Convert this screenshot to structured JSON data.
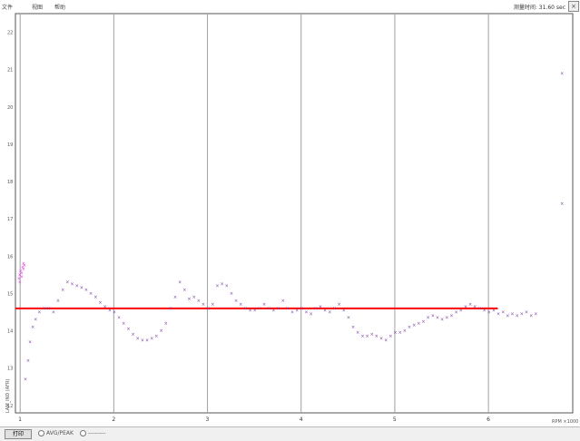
{
  "menu": [
    "文件",
    "视图",
    "帮助"
  ],
  "top_right_text": "测量时间: 31.60 sec",
  "top_right_box": "×",
  "top_marker_text": "■ ■ ■ ■ ■ ■ ■ ■ ■ ■ ■ ■ ■ ■ ■ ■ ■",
  "bottom": {
    "button_label": "打印",
    "radio1_label": "AVG/PEAK",
    "radio2_label": "---------"
  },
  "colors": {
    "plot_border": "#555555",
    "grid": "#a0a0a0",
    "series": "#8040a0",
    "reference_line": "#ff0000",
    "magenta": "#e040e0"
  },
  "chart_data": {
    "type": "scatter",
    "title": "",
    "xlabel": "RPM ×1000",
    "ylabel": "LAM_IND (AFR)",
    "xlim": [
      0.95,
      6.9
    ],
    "ylim": [
      11.8,
      22.5
    ],
    "x_ticks": [
      1,
      2,
      3,
      4,
      5,
      6
    ],
    "y_ticks": [
      12,
      13,
      14,
      15,
      16,
      17,
      18,
      19,
      20,
      21,
      22
    ],
    "grid": true,
    "legend": "none",
    "reference_line": 14.6,
    "series": [
      {
        "name": "",
        "x": [
          1.05,
          1.08,
          1.1,
          1.13,
          1.16,
          1.2,
          1.25,
          1.3,
          1.35,
          1.4,
          1.45,
          1.5,
          1.55,
          1.6,
          1.65,
          1.7,
          1.75,
          1.8,
          1.85,
          1.9,
          1.95,
          2.0,
          2.05,
          2.1,
          2.15,
          2.2,
          2.25,
          2.3,
          2.35,
          2.4,
          2.45,
          2.5,
          2.55,
          2.6,
          2.65,
          2.7,
          2.75,
          2.8,
          2.85,
          2.9,
          2.95,
          3.0,
          3.05,
          3.1,
          3.15,
          3.2,
          3.25,
          3.3,
          3.35,
          3.4,
          3.45,
          3.5,
          3.55,
          3.6,
          3.65,
          3.7,
          3.75,
          3.8,
          3.85,
          3.9,
          3.95,
          4.0,
          4.05,
          4.1,
          4.15,
          4.2,
          4.25,
          4.3,
          4.35,
          4.4,
          4.45,
          4.5,
          4.55,
          4.6,
          4.65,
          4.7,
          4.75,
          4.8,
          4.85,
          4.9,
          4.95,
          5.0,
          5.05,
          5.1,
          5.15,
          5.2,
          5.25,
          5.3,
          5.35,
          5.4,
          5.45,
          5.5,
          5.55,
          5.6,
          5.65,
          5.7,
          5.75,
          5.8,
          5.85,
          5.9,
          5.95,
          6.0,
          6.05,
          6.1,
          6.15,
          6.2,
          6.25,
          6.3,
          6.35,
          6.4,
          6.45,
          6.5
        ],
        "y": [
          12.7,
          13.2,
          13.7,
          14.1,
          14.3,
          14.5,
          14.6,
          14.6,
          14.5,
          14.8,
          15.1,
          15.3,
          15.25,
          15.2,
          15.15,
          15.1,
          15.0,
          14.9,
          14.75,
          14.65,
          14.55,
          14.5,
          14.35,
          14.2,
          14.05,
          13.9,
          13.8,
          13.75,
          13.75,
          13.8,
          13.85,
          14.0,
          14.2,
          14.6,
          14.9,
          15.3,
          15.1,
          14.85,
          14.9,
          14.8,
          14.7,
          14.6,
          14.7,
          15.2,
          15.25,
          15.2,
          15.0,
          14.8,
          14.7,
          14.6,
          14.55,
          14.55,
          14.6,
          14.7,
          14.6,
          14.55,
          14.6,
          14.8,
          14.6,
          14.5,
          14.55,
          14.6,
          14.5,
          14.45,
          14.6,
          14.65,
          14.55,
          14.5,
          14.6,
          14.7,
          14.55,
          14.35,
          14.1,
          13.95,
          13.85,
          13.85,
          13.9,
          13.85,
          13.8,
          13.75,
          13.85,
          13.95,
          13.95,
          14.0,
          14.1,
          14.15,
          14.2,
          14.25,
          14.35,
          14.4,
          14.35,
          14.3,
          14.35,
          14.4,
          14.5,
          14.55,
          14.65,
          14.7,
          14.65,
          14.6,
          14.55,
          14.5,
          14.55,
          14.45,
          14.5,
          14.4,
          14.45,
          14.4,
          14.45,
          14.5,
          14.4,
          14.45
        ]
      },
      {
        "name": "",
        "x": [
          0.98,
          0.99,
          1.0,
          1.01,
          1.02,
          1.03,
          1.04,
          0.99,
          1.01,
          1.03
        ],
        "y": [
          15.4,
          15.5,
          15.6,
          15.55,
          15.7,
          15.8,
          15.75,
          15.3,
          15.45,
          15.65
        ]
      },
      {
        "name": "",
        "x": [
          6.78,
          6.78
        ],
        "y": [
          20.9,
          17.4
        ]
      }
    ]
  }
}
